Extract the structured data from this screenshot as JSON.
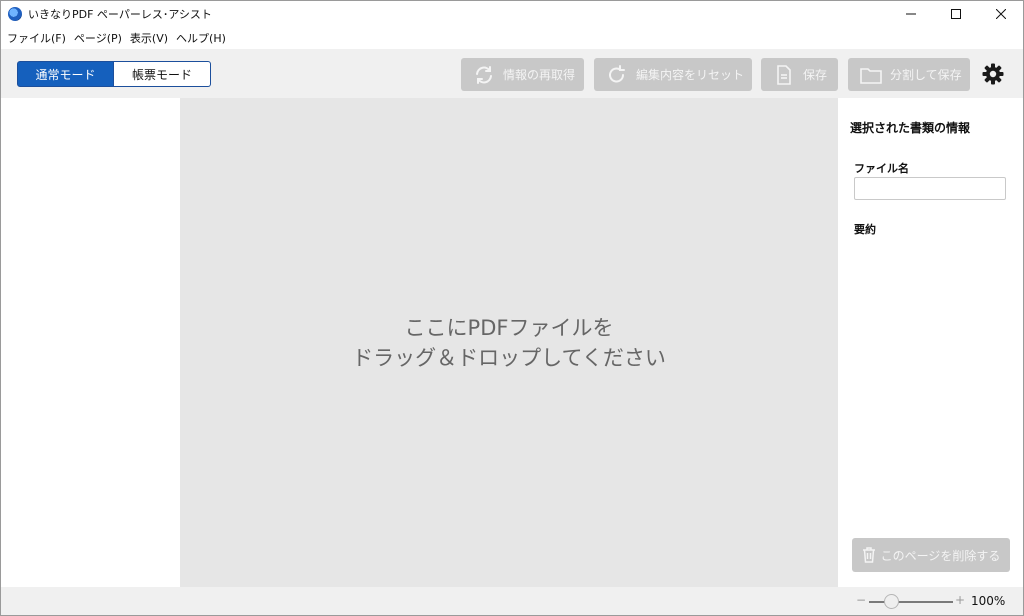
{
  "window": {
    "title": "いきなりPDF ペーパーレス･アシスト",
    "controls": [
      "minimize-icon",
      "maximize-icon",
      "close-icon"
    ]
  },
  "menu": {
    "items": [
      "ファイル(F)",
      "ページ(P)",
      "表示(V)",
      "ヘルプ(H)"
    ]
  },
  "toolbar": {
    "mode_normal": "通常モード",
    "mode_form": "帳票モード",
    "refetch_label": "情報の再取得",
    "reset_label": "編集内容をリセット",
    "save_label": "保存",
    "split_save_label": "分割して保存",
    "settings_icon": "gear-icon"
  },
  "drop_zone": {
    "line1": "ここにPDFファイルを",
    "line2": "ドラッグ＆ドロップしてください"
  },
  "info_panel": {
    "title": "選択された書類の情報",
    "filename_label": "ファイル名",
    "filename_value": "",
    "summary_label": "要約",
    "delete_page_label": "このページを削除する"
  },
  "status": {
    "zoom_minus": "−",
    "zoom_plus": "+",
    "zoom_level": "100%",
    "zoom_fraction": 0.22
  },
  "colors": {
    "accent": "#1560bd",
    "disabled_button": "#c8c8c8",
    "drop_zone_bg": "#e6e6e6",
    "toolbar_bg": "#f0f0f0"
  }
}
